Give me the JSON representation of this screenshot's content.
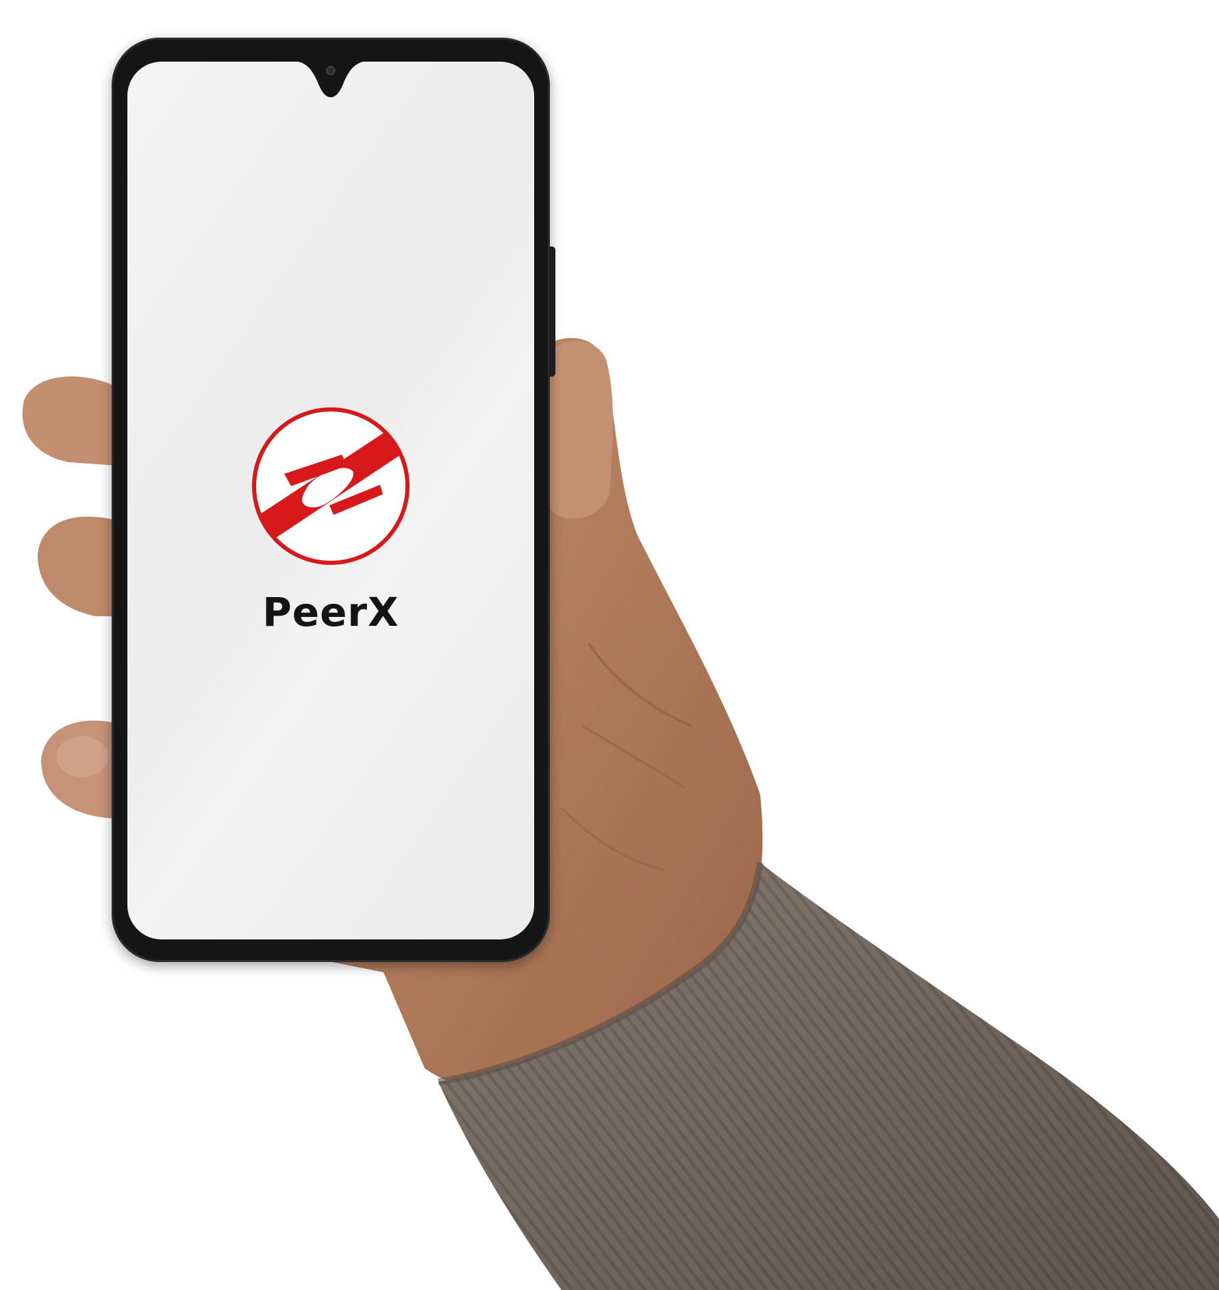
{
  "app": {
    "name": "PeerX",
    "logo_icon": "peerx-logo-icon",
    "brand_color": "#d7191c"
  },
  "device": {
    "type": "smartphone",
    "screen_background": "#efefef",
    "frame_color": "#151515"
  },
  "scene": {
    "background_color": "#ffffff",
    "skin_color": "#b98566",
    "sleeve_color": "#7a6f66"
  }
}
